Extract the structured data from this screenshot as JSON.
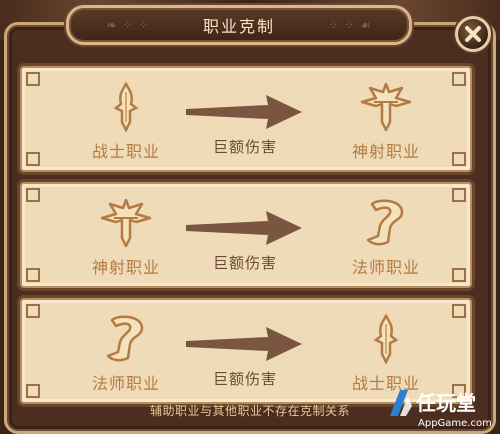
{
  "dialog": {
    "title": "职业克制",
    "close_icon": "close-icon"
  },
  "rows": [
    {
      "attacker": {
        "label": "战士职业",
        "icon": "sword-icon"
      },
      "effect": "巨额伤害",
      "target": {
        "label": "神射职业",
        "icon": "crossbow-icon"
      }
    },
    {
      "attacker": {
        "label": "神射职业",
        "icon": "crossbow-icon"
      },
      "effect": "巨额伤害",
      "target": {
        "label": "法师职业",
        "icon": "mage-scroll-icon"
      }
    },
    {
      "attacker": {
        "label": "法师职业",
        "icon": "mage-scroll-icon"
      },
      "effect": "巨额伤害",
      "target": {
        "label": "战士职业",
        "icon": "sword-icon"
      }
    }
  ],
  "footer_note": "辅助职业与其他职业不存在克制关系",
  "watermark": {
    "brand": "任玩堂",
    "site": "AppGame.com"
  },
  "colors": {
    "card_bg": "#f0dbb8",
    "label_gold": "#b27b44",
    "arrow_brown": "#6a4a34",
    "frame_dark": "#4b2e1f"
  }
}
